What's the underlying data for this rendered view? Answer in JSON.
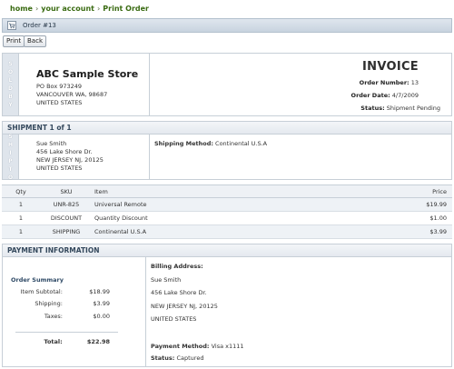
{
  "breadcrumb": {
    "home": "home",
    "account": "your account",
    "current": "Print Order",
    "separator": "›"
  },
  "title_bar": {
    "title": "Order #13",
    "icon": "cart-icon"
  },
  "toolbar": {
    "print_label": "Print",
    "back_label": "Back"
  },
  "store": {
    "strip_label": [
      "S",
      "O",
      "L",
      "D",
      "B",
      "Y"
    ],
    "name": "ABC Sample Store",
    "address_lines": [
      "PO Box 973249",
      "VANCOUVER WA, 98687",
      "UNITED STATES"
    ]
  },
  "invoice": {
    "title": "INVOICE",
    "order_number_label": "Order Number:",
    "order_number": "13",
    "order_date_label": "Order Date:",
    "order_date": "4/7/2009",
    "status_label": "Status:",
    "status": "Shipment Pending"
  },
  "shipment": {
    "heading": "SHIPMENT 1 of 1",
    "strip_label": [
      "S",
      "H",
      "I",
      "P",
      "T",
      "O"
    ],
    "address_lines": [
      "Sue Smith",
      "456 Lake Shore Dr.",
      "NEW JERSEY NJ, 20125",
      "UNITED STATES"
    ],
    "method_label": "Shipping Method:",
    "method": "Continental U.S.A"
  },
  "items": {
    "columns": {
      "qty": "Qty",
      "sku": "SKU",
      "item": "Item",
      "price": "Price"
    },
    "rows": [
      {
        "qty": "1",
        "sku": "UNR-825",
        "item": "Universal Remote",
        "price": "$19.99"
      },
      {
        "qty": "1",
        "sku": "DISCOUNT",
        "item": "Quantity Discount",
        "price": "$1.00"
      },
      {
        "qty": "1",
        "sku": "SHIPPING",
        "item": "Continental U.S.A",
        "price": "$3.99"
      }
    ]
  },
  "payment": {
    "heading": "PAYMENT INFORMATION",
    "summary_title": "Order Summary",
    "subtotal_label": "Item Subtotal:",
    "subtotal": "$18.99",
    "shipping_label": "Shipping:",
    "shipping": "$3.99",
    "taxes_label": "Taxes:",
    "taxes": "$0.00",
    "total_label": "Total:",
    "total": "$22.98",
    "billing_heading": "Billing Address:",
    "billing_lines": [
      "Sue Smith",
      "456 Lake Shore Dr.",
      "NEW JERSEY NJ, 20125",
      "UNITED STATES"
    ],
    "method_label": "Payment Method:",
    "method": "Visa x1111",
    "status_label": "Status:",
    "status": "Captured"
  }
}
